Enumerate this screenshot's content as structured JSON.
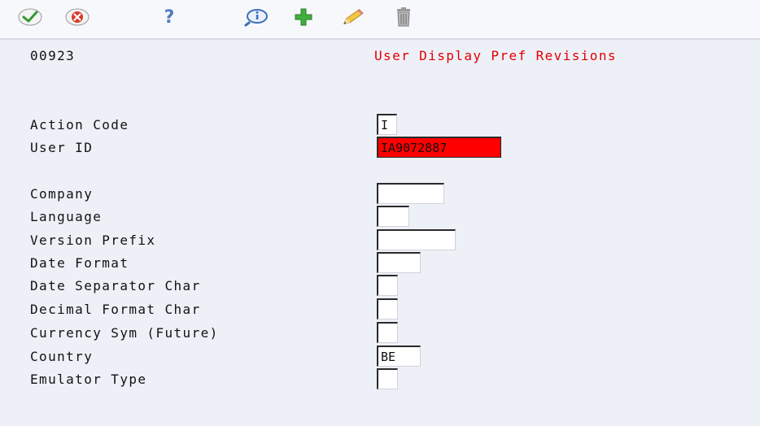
{
  "toolbar": {
    "ok": "check-icon",
    "cancel": "cancel-icon",
    "help": "?",
    "inquire": "inquire-icon",
    "add": "plus-icon",
    "change": "pencil-icon",
    "delete": "trash-icon"
  },
  "screen": {
    "id": "00923",
    "title": "User Display Pref Revisions"
  },
  "labels": {
    "action_code": "Action Code",
    "user_id": "User ID",
    "company": "Company",
    "language": "Language",
    "version_prefix": "Version Prefix",
    "date_format": "Date Format",
    "date_separator": "Date Separator Char",
    "decimal_format": "Decimal Format Char",
    "currency_sym": "Currency Sym (Future)",
    "country": "Country",
    "emulator_type": "Emulator Type"
  },
  "values": {
    "action_code": "I",
    "user_id": "IA9072887",
    "company": "",
    "language": "",
    "version_prefix": "",
    "date_format": "",
    "date_separator": "",
    "decimal_format": "",
    "currency_sym": "",
    "country": "BE",
    "emulator_type": ""
  },
  "colors": {
    "title": "#e00000",
    "error_field": "#ff0000",
    "background": "#eef0f8"
  }
}
